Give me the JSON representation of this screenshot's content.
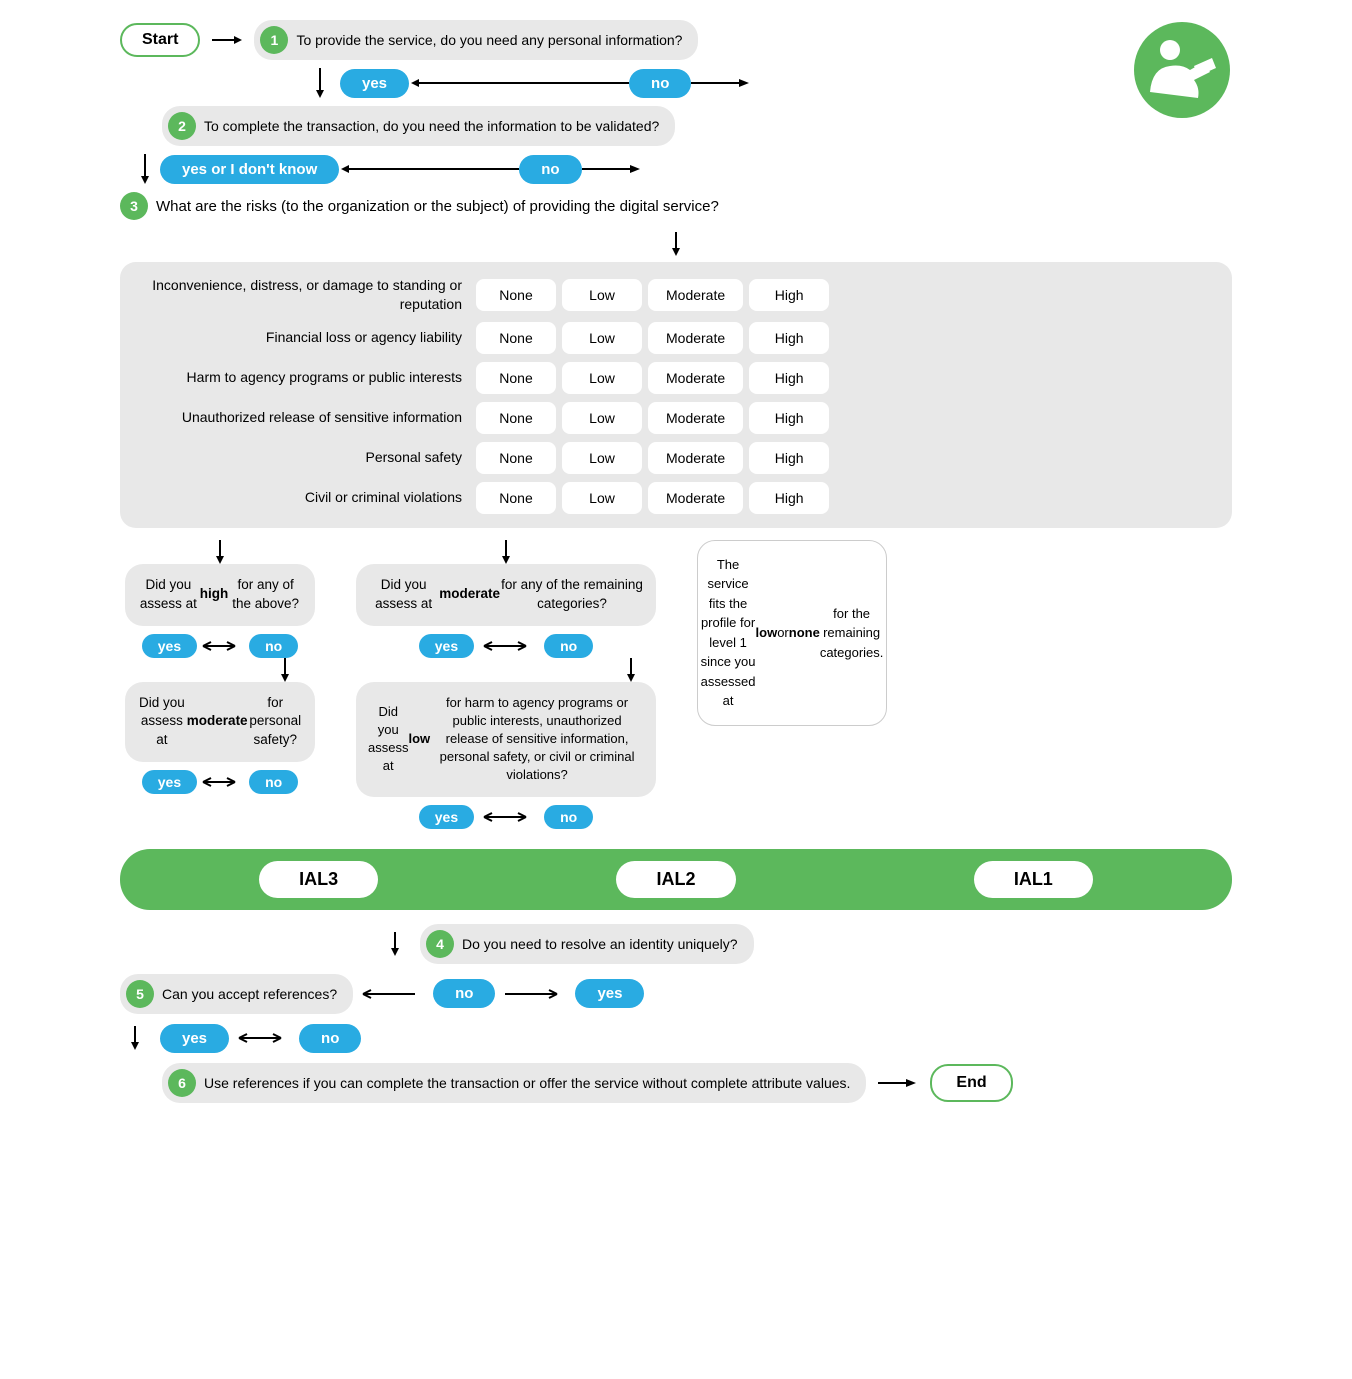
{
  "start_label": "Start",
  "end_label": "End",
  "icon_alt": "Identity verification person icon",
  "steps": [
    {
      "number": "1",
      "text": "To provide the service, do you need any personal information?"
    },
    {
      "number": "2",
      "text": "To complete the transaction, do you need the information to be validated?"
    },
    {
      "number": "3",
      "text": "What are the risks (to the organization or the subject) of providing the digital service?"
    },
    {
      "number": "4",
      "text": "Do you need to resolve an identity uniquely?"
    },
    {
      "number": "5",
      "text": "Can you accept references?"
    },
    {
      "number": "6",
      "text": "Use references if you can complete the transaction or offer the service without complete attribute values."
    }
  ],
  "buttons": {
    "yes": "yes",
    "no": "no",
    "yes_or_dont_know": "yes or I don't know"
  },
  "risk_categories": [
    "Inconvenience, distress, or damage to standing or reputation",
    "Financial loss or agency liability",
    "Harm to agency programs or public interests",
    "Unauthorized release of sensitive information",
    "Personal safety",
    "Civil or criminal violations"
  ],
  "risk_levels": [
    "None",
    "Low",
    "Moderate",
    "High"
  ],
  "ial_levels": [
    "IAL3",
    "IAL2",
    "IAL1"
  ],
  "decision_nodes": {
    "high_check": "Did you assess at high for any of the above?",
    "moderate_personal_safety": "Did you assess at moderate for personal safety?",
    "moderate_remaining": "Did you assess at moderate for any of the remaining categories?",
    "low_specific": "Did you assess at low for harm to agency programs or public interests, unauthorized release of sensitive information, personal safety, or civil or criminal violations?",
    "level1_description": "The service fits the profile for level 1 since you assessed at low or none for the remaining categories."
  }
}
